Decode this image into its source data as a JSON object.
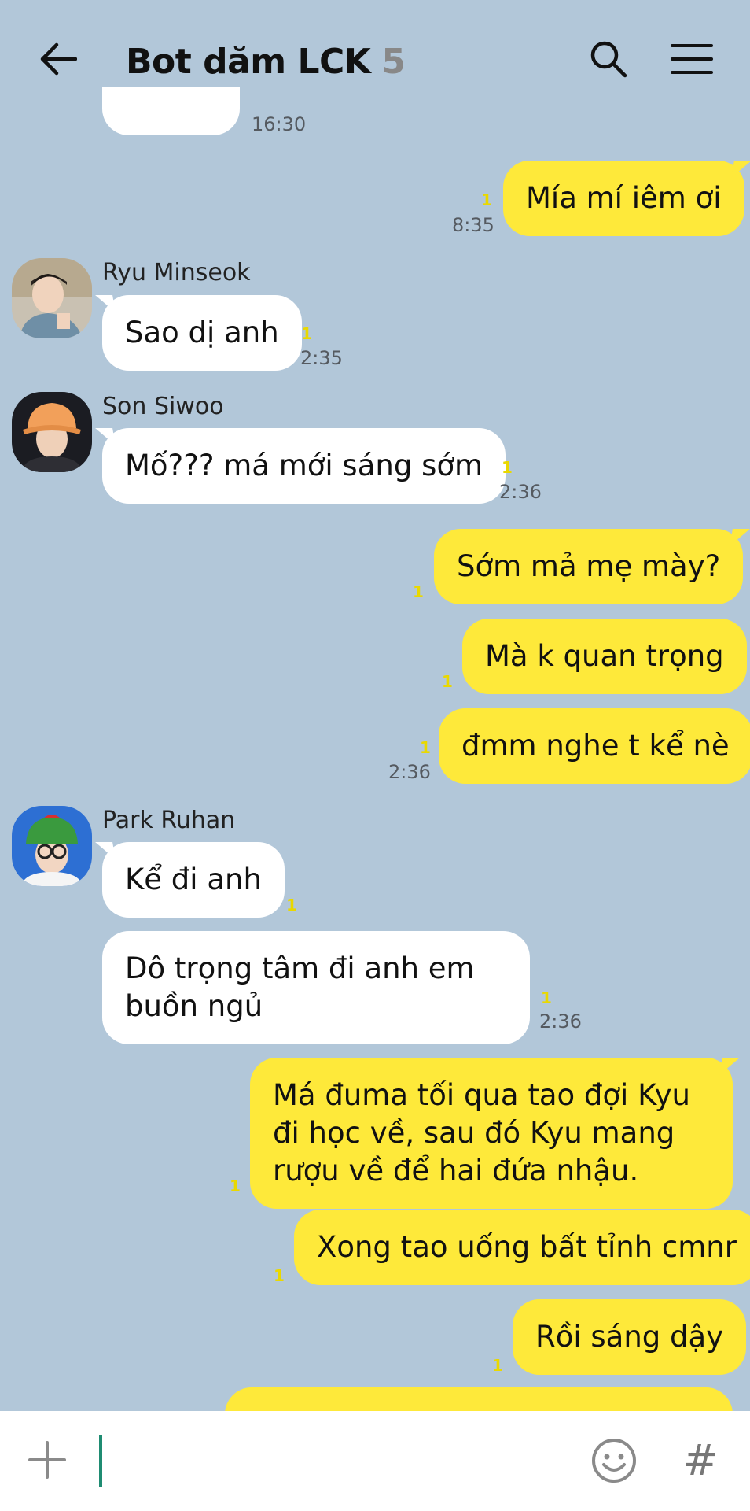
{
  "header": {
    "title": "Bot dăm LCK",
    "member_count": "5"
  },
  "messages": {
    "m0": {
      "time": "16:30"
    },
    "m1": {
      "text": "Mía mí iêm ơi",
      "unread": "1",
      "time": "8:35"
    },
    "m2": {
      "sender": "Ryu Minseok",
      "text": "Sao dị anh",
      "unread": "1",
      "time": "2:35"
    },
    "m3": {
      "sender": "Son Siwoo",
      "text": "Mố??? má mới sáng sớm",
      "unread": "1",
      "time": "2:36"
    },
    "m4": {
      "text": "Sớm mả mẹ mày?",
      "unread": "1"
    },
    "m5": {
      "text": "Mà k quan trọng",
      "unread": "1"
    },
    "m6": {
      "text": "đmm nghe t kể nè",
      "unread": "1",
      "time": "2:36"
    },
    "m7": {
      "sender": "Park Ruhan",
      "text": "Kể đi anh",
      "unread": "1"
    },
    "m8": {
      "text": "Dô trọng tâm đi anh em buồn ngủ",
      "unread": "1",
      "time": "2:36"
    },
    "m9": {
      "text": "Má đuma tối qua tao đợi Kyu đi học về, sau đó Kyu mang rượu về để hai đứa nhậu.",
      "unread": "1"
    },
    "m10": {
      "text": "Xong tao uống bất tỉnh cmnr",
      "unread": "1"
    },
    "m11": {
      "text": "Rồi sáng dậy",
      "unread": "1"
    }
  },
  "input": {
    "value": "",
    "placeholder": ""
  },
  "icons": {
    "back": "arrow-left-icon",
    "search": "search-icon",
    "menu": "hamburger-menu-icon",
    "plus": "plus-icon",
    "emoji": "emoji-icon",
    "hash": "#"
  },
  "colors": {
    "background": "#b2c7d9",
    "outgoing_bubble": "#fee93a",
    "incoming_bubble": "#ffffff",
    "unread": "#e9d800",
    "cursor": "#1f8c72"
  }
}
